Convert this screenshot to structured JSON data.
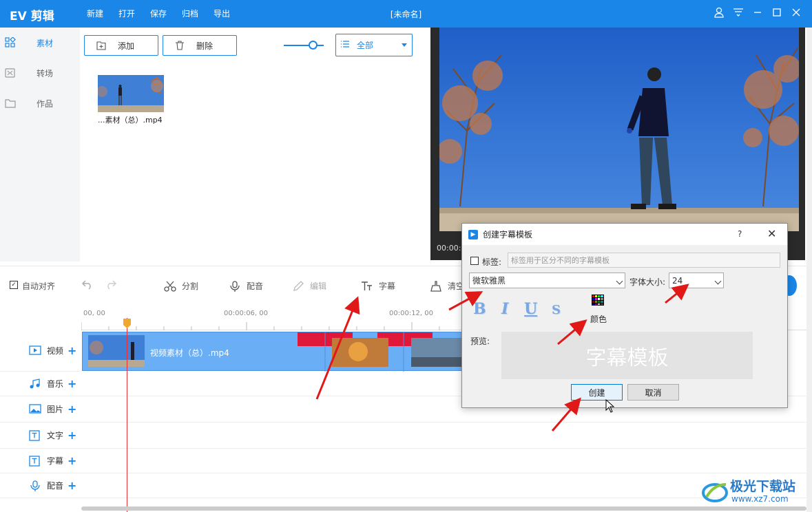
{
  "titlebar": {
    "app_name": "EV 剪辑",
    "menu": [
      "新建",
      "打开",
      "保存",
      "归档",
      "导出"
    ],
    "window_title": "[未命名]"
  },
  "sidebar": {
    "items": [
      {
        "label": "素材",
        "icon": "grid-icon",
        "active": true
      },
      {
        "label": "转场",
        "icon": "transition-icon",
        "active": false
      },
      {
        "label": "作品",
        "icon": "folder-icon",
        "active": false
      }
    ]
  },
  "media": {
    "add_label": "添加",
    "delete_label": "删除",
    "filter_value": "全部",
    "thumb_label": "...素材（总）.mp4"
  },
  "preview": {
    "time": "00:00:"
  },
  "toolbar": {
    "auto_align": "自动对齐",
    "split": "分割",
    "dub": "配音",
    "edit": "编辑",
    "subtitle": "字幕",
    "clear": "清空"
  },
  "ruler": {
    "ticks": [
      "00, 00",
      "00:00:06, 00",
      "00:00:12, 00"
    ]
  },
  "tracks": {
    "items": [
      {
        "label": "视频",
        "icon": "video-icon"
      },
      {
        "label": "音乐",
        "icon": "music-icon"
      },
      {
        "label": "图片",
        "icon": "image-icon"
      },
      {
        "label": "文字",
        "icon": "text-icon"
      },
      {
        "label": "字幕",
        "icon": "subtitle-icon"
      },
      {
        "label": "配音",
        "icon": "mic-icon"
      }
    ],
    "clip_label": "视频素材（总）.mp4"
  },
  "dialog": {
    "title": "创建字幕模板",
    "help": "?",
    "close": "✕",
    "tag_label": "标签:",
    "tag_placeholder": "标签用于区分不同的字幕模板",
    "font_value": "微软雅黑",
    "size_label": "字体大小:",
    "size_value": "24",
    "bold": "B",
    "italic": "I",
    "underline": "U",
    "strike": "S",
    "color_label": "颜色",
    "preview_label": "预览:",
    "preview_text": "字幕模板",
    "create": "创建",
    "cancel": "取消"
  },
  "watermark": {
    "text": "极光下载站",
    "url": "www.xz7.com"
  }
}
